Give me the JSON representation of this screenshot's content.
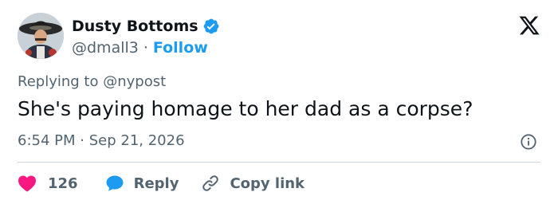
{
  "author": {
    "display_name": "Dusty Bottoms",
    "handle": "@dmall3",
    "separator": "·",
    "follow_label": "Follow",
    "verified": true
  },
  "reply_context": {
    "prefix": "Replying to",
    "mention": "@nypost"
  },
  "tweet": {
    "text": "She's paying homage to her dad as a corpse?",
    "time": "6:54 PM",
    "date_separator": "·",
    "date": "Sep 21, 2026"
  },
  "actions": {
    "like_count": "126",
    "reply_label": "Reply",
    "copy_label": "Copy link"
  },
  "icons": {
    "verified": "verified-badge-icon",
    "brand": "x-logo-icon",
    "info": "info-icon",
    "like": "heart-icon",
    "reply": "speech-bubble-icon",
    "copy": "link-icon"
  },
  "colors": {
    "accent": "#1d9bf0",
    "like": "#f91880",
    "text": "#0f1419",
    "muted": "#536471",
    "divider": "#cfd9de"
  }
}
